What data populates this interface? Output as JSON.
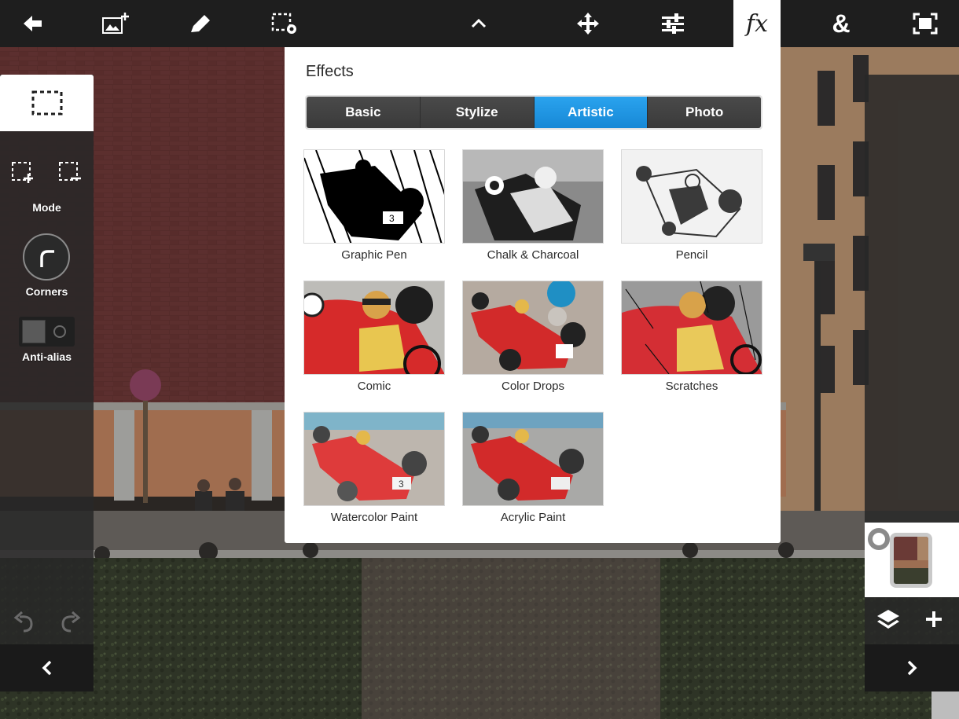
{
  "toolbar": {
    "items": [
      {
        "name": "back",
        "icon": "back-arrow-icon"
      },
      {
        "name": "add-image",
        "icon": "add-image-icon"
      },
      {
        "name": "brush",
        "icon": "pencil-icon"
      },
      {
        "name": "selection-settings",
        "icon": "selection-gear-icon"
      },
      {
        "name": "collapse",
        "icon": "chevron-up-icon"
      },
      {
        "name": "move",
        "icon": "move-icon"
      },
      {
        "name": "adjustments",
        "icon": "sliders-icon"
      },
      {
        "name": "effects",
        "icon": "fx-icon",
        "label": "fx",
        "active": true
      },
      {
        "name": "blend",
        "icon": "ampersand-icon",
        "label": "&"
      },
      {
        "name": "fit",
        "icon": "fit-screen-icon"
      }
    ]
  },
  "left_panel": {
    "mode_label": "Mode",
    "corners_label": "Corners",
    "antialias_label": "Anti-alias",
    "antialias_on": false
  },
  "effects": {
    "title": "Effects",
    "tabs": [
      {
        "label": "Basic",
        "selected": false
      },
      {
        "label": "Stylize",
        "selected": false
      },
      {
        "label": "Artistic",
        "selected": true
      },
      {
        "label": "Photo",
        "selected": false
      }
    ],
    "items": [
      {
        "label": "Graphic Pen"
      },
      {
        "label": "Chalk & Charcoal"
      },
      {
        "label": "Pencil"
      },
      {
        "label": "Comic"
      },
      {
        "label": "Color Drops"
      },
      {
        "label": "Scratches"
      },
      {
        "label": "Watercolor Paint"
      },
      {
        "label": "Acrylic Paint"
      }
    ]
  },
  "colors": {
    "toolbar_bg": "#1e1e1e",
    "accent_blue": "#1788d6",
    "panel_bg": "#ffffff"
  }
}
